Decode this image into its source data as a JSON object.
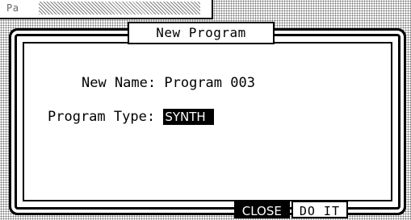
{
  "background": {
    "tab_text": "Pa"
  },
  "dialog": {
    "title": "New Program",
    "name_label": "New Name:",
    "name_value": "Program 003",
    "type_label": "Program Type:",
    "type_value": "SYNTH"
  },
  "buttons": {
    "close_label": "CLOSE",
    "doit_label": "DO IT"
  }
}
